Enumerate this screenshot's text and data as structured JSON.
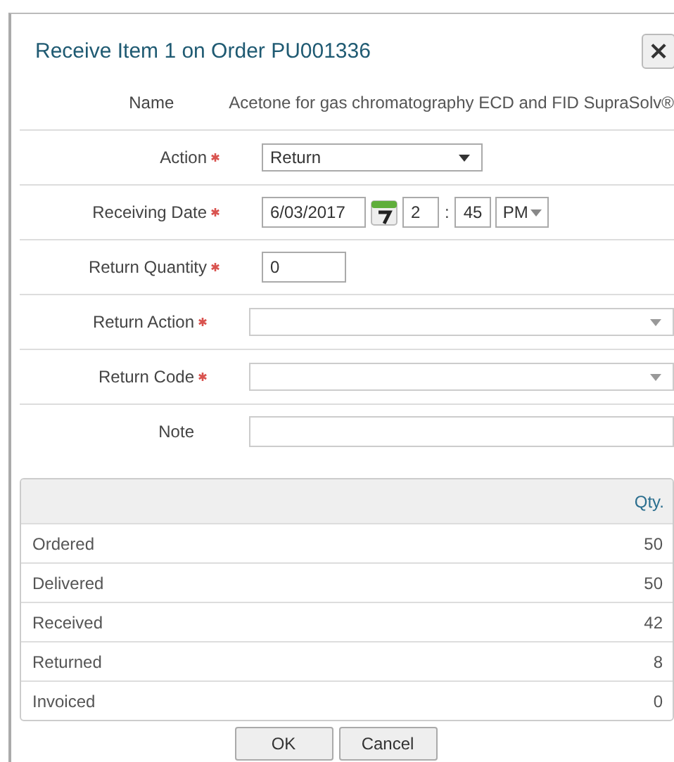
{
  "dialog": {
    "title": "Receive Item 1 on Order PU001336",
    "close": "×"
  },
  "form": {
    "fields": [
      {
        "kind": "text",
        "label": "Name",
        "required": false,
        "value": "Acetone for gas chromatography ECD and FID SupraSolv®"
      },
      {
        "kind": "select",
        "label": "Action",
        "required": true,
        "value": "Return"
      },
      {
        "kind": "datetime",
        "label": "Receiving Date",
        "required": true,
        "date": "6/03/2017",
        "hour": "2",
        "separator": ":",
        "minute": "45",
        "ampm": "PM"
      },
      {
        "kind": "number",
        "label": "Return Quantity",
        "required": true,
        "value": "0"
      },
      {
        "kind": "combo",
        "label": "Return Action",
        "required": true
      },
      {
        "kind": "combo",
        "label": "Return Code",
        "required": true
      },
      {
        "kind": "textbox",
        "label": "Note",
        "required": false
      }
    ]
  },
  "quantities": {
    "columns": [
      "Qty."
    ],
    "rows": [
      {
        "label": "Ordered",
        "qty": "50"
      },
      {
        "label": "Delivered",
        "qty": "50"
      },
      {
        "label": "Received",
        "qty": "42"
      },
      {
        "label": "Returned",
        "qty": "8"
      },
      {
        "label": "Invoiced",
        "qty": "0"
      }
    ]
  },
  "buttons": [
    "OK",
    "Cancel"
  ]
}
